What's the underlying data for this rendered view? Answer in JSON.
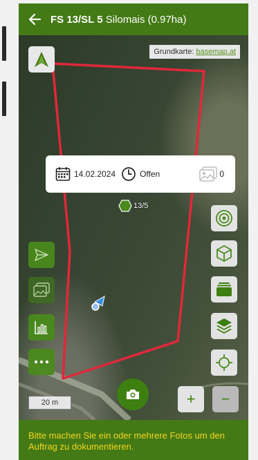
{
  "header": {
    "title_bold": "FS 13/SL 5",
    "title_rest": " Silomais (0.97ha)",
    "back_icon": "arrow-left-icon"
  },
  "map": {
    "basemap_label": "Grundkarte: ",
    "basemap_link": "basemap.at",
    "task_card": {
      "date": "14.02.2024",
      "status": "Offen",
      "photo_count": "0"
    },
    "field_label": "13/5",
    "scale_label": "20 m",
    "boundary_color": "#e0283a",
    "accent_color": "#447a15",
    "notice_color": "#f3d51e"
  },
  "left_buttons": [
    {
      "name": "send-button",
      "icon": "send-icon"
    },
    {
      "name": "gallery-button",
      "icon": "image-icon"
    },
    {
      "name": "chart-button",
      "icon": "bar-chart-icon"
    },
    {
      "name": "more-button",
      "icon": "more-icon"
    }
  ],
  "right_buttons": [
    {
      "name": "target-button",
      "icon": "target-icon"
    },
    {
      "name": "3d-button",
      "icon": "cube-icon"
    },
    {
      "name": "layer-button",
      "icon": "folder-stack-icon"
    },
    {
      "name": "layers-button",
      "icon": "layers-icon"
    },
    {
      "name": "locate-button",
      "icon": "crosshair-icon"
    }
  ],
  "zoom": {
    "in_label": "+",
    "out_label": "−"
  },
  "footer": {
    "notice": "Bitte machen Sie ein oder mehrere Fotos um den Auftrag zu dokumentieren."
  }
}
